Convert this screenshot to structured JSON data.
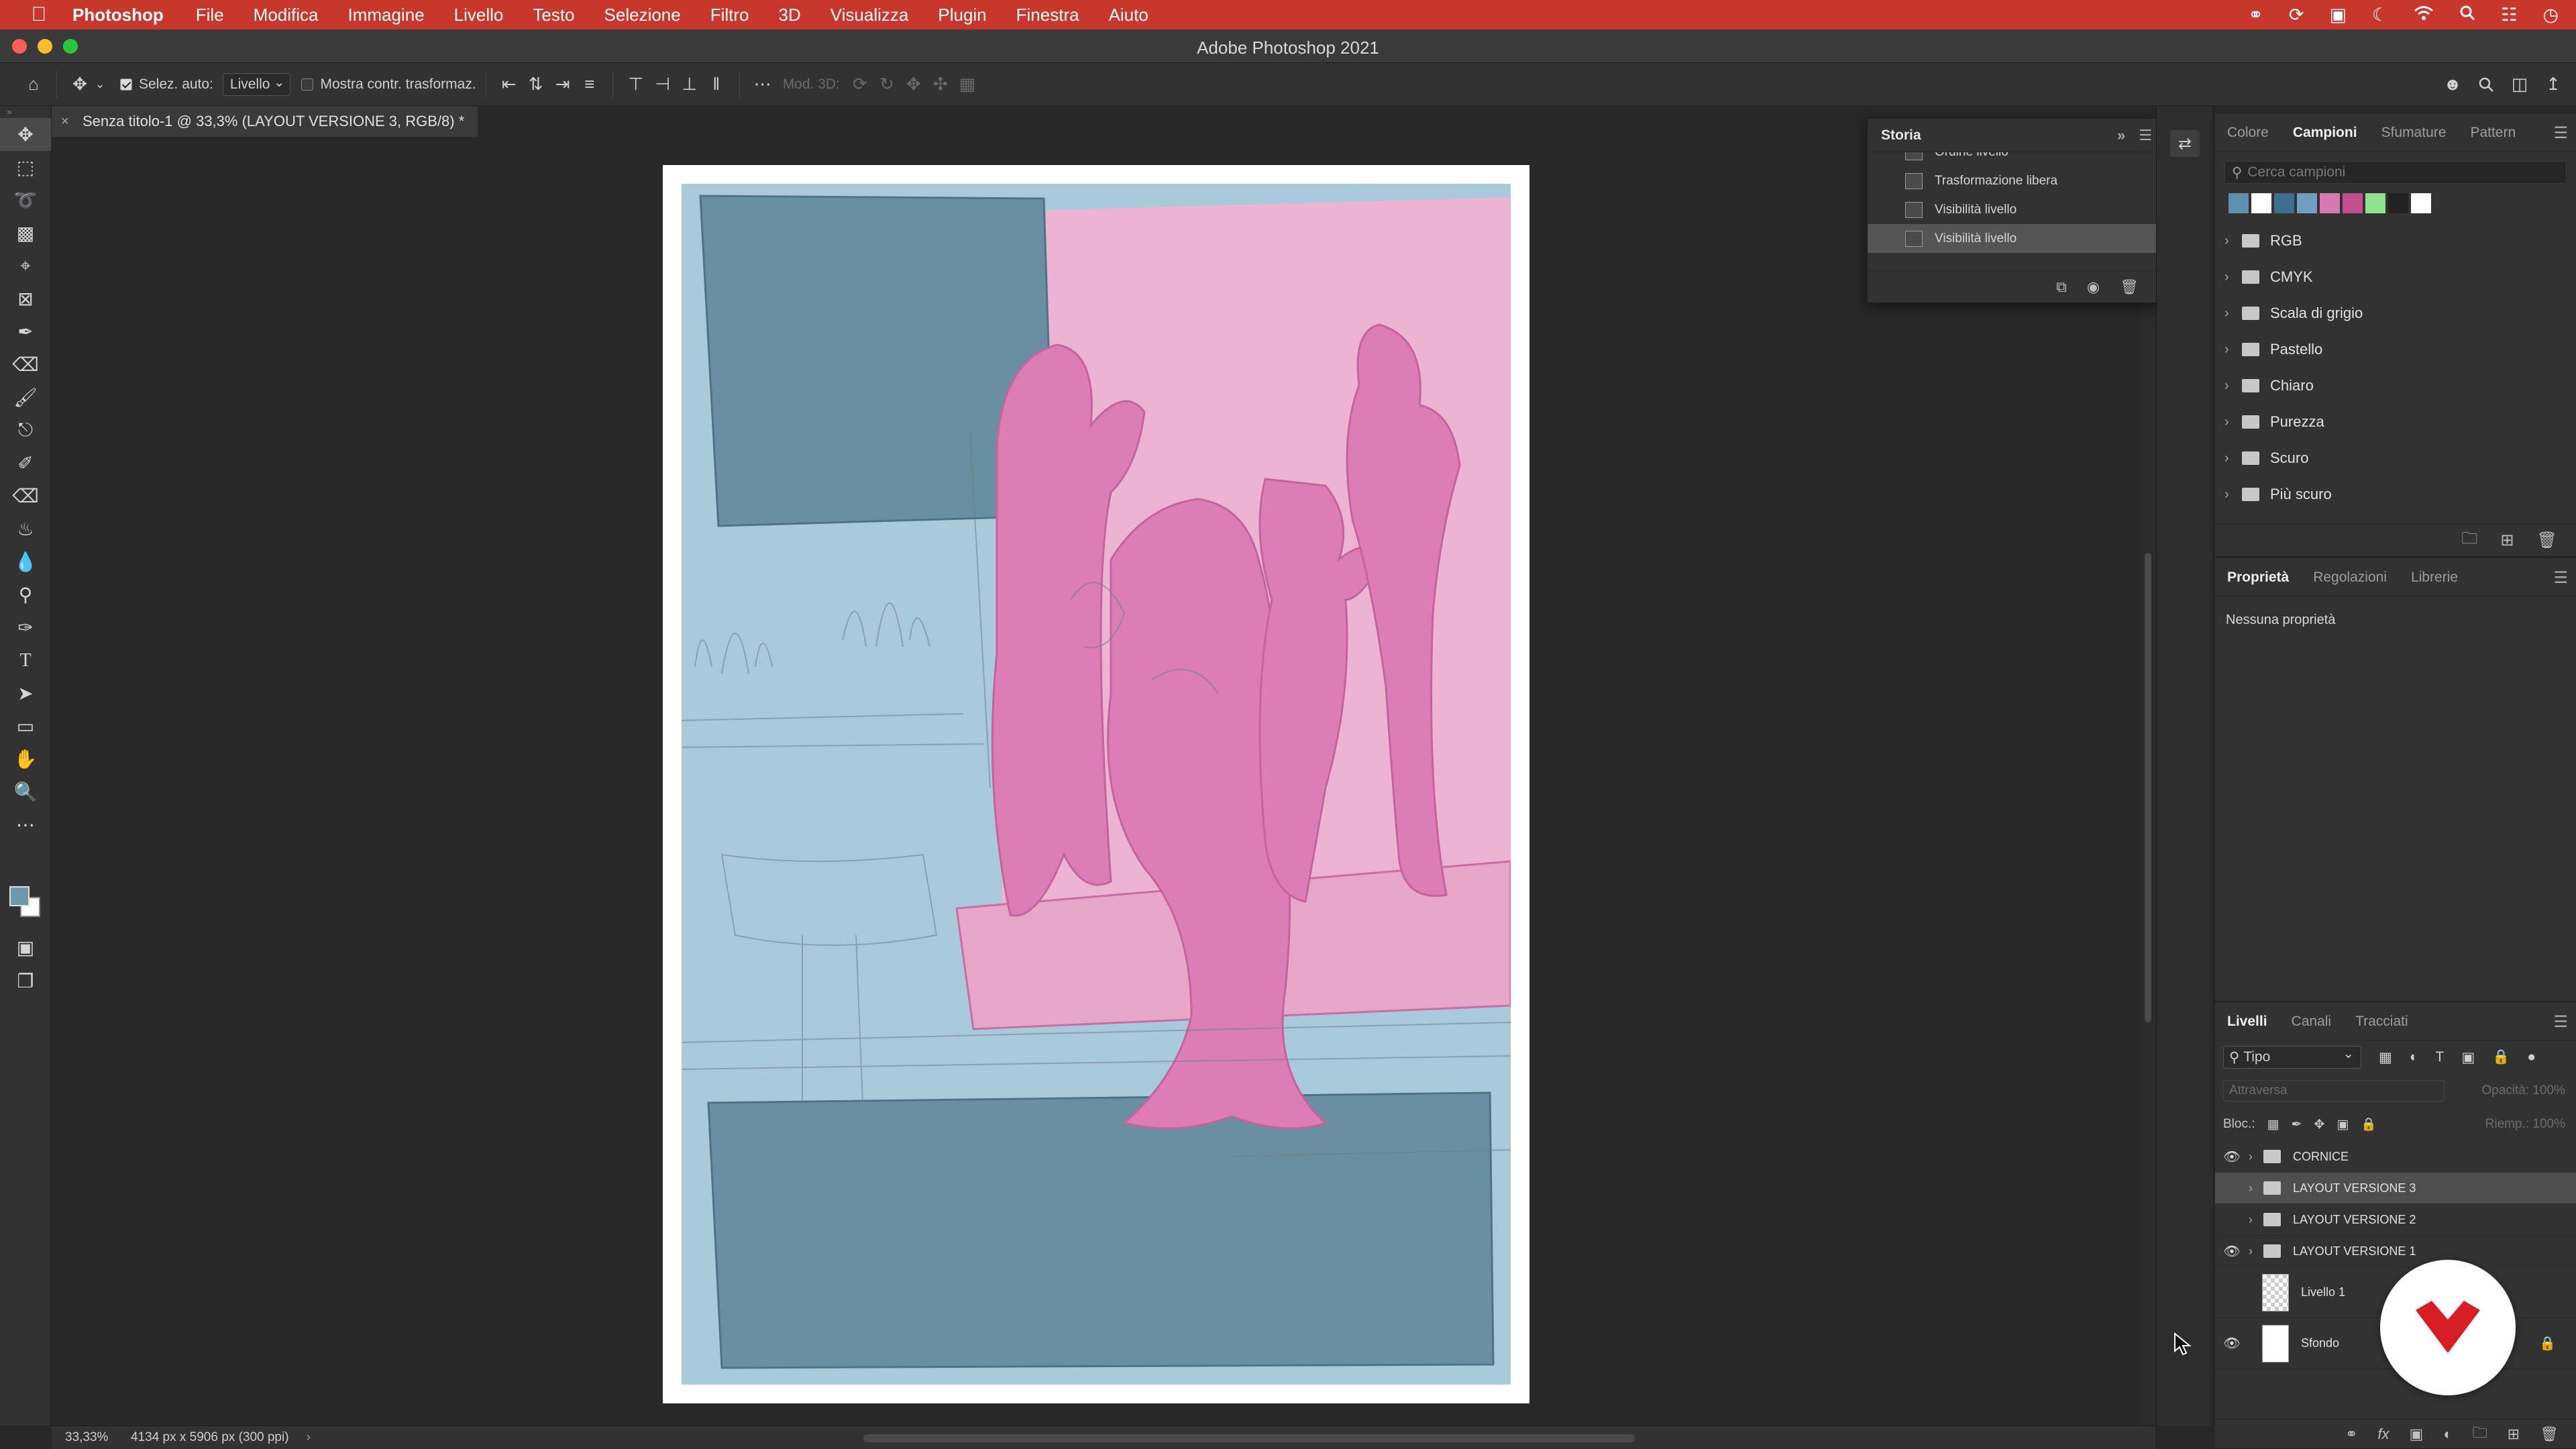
{
  "menubar": {
    "apple_icon": "apple-logo-icon",
    "app_name": "Photoshop",
    "items": [
      "File",
      "Modifica",
      "Immagine",
      "Livello",
      "Testo",
      "Selezione",
      "Filtro",
      "3D",
      "Visualizza",
      "Plugin",
      "Finestra",
      "Aiuto"
    ],
    "status_icons": [
      "creative-cloud-icon",
      "sync-icon",
      "screen-mirroring-icon",
      "moon-icon",
      "wifi-icon",
      "spotlight-search-icon",
      "control-center-icon",
      "clock-icon"
    ]
  },
  "window": {
    "title": "Adobe Photoshop 2021"
  },
  "options_bar": {
    "auto_select_label": "Selez. auto:",
    "auto_select_checked": true,
    "auto_select_target": "Livello",
    "transform_controls_label": "Mostra contr. trasformaz.",
    "transform_controls_checked": false,
    "mode_3d_label": "Mod. 3D:"
  },
  "document_tab": {
    "close_glyph": "×",
    "title": "Senza titolo-1 @ 33,3% (LAYOUT VERSIONE 3, RGB/8) *"
  },
  "toolbar": {
    "tools": [
      "move-tool",
      "rectangular-marquee-tool",
      "lasso-tool",
      "object-selection-tool",
      "crop-tool",
      "frame-tool",
      "eyedropper-tool",
      "spot-healing-tool",
      "brush-tool",
      "clone-stamp-tool",
      "history-brush-tool",
      "eraser-tool",
      "paint-bucket-tool",
      "blur-tool",
      "dodge-tool",
      "pen-tool",
      "type-tool",
      "path-selection-tool",
      "rectangle-tool",
      "hand-tool",
      "zoom-tool",
      "edit-toolbar"
    ],
    "foreground_color": "#6f98ad",
    "background_color": "#ffffff"
  },
  "history_panel": {
    "title": "Storia",
    "items": [
      {
        "label": "Ordine livello",
        "selected": false
      },
      {
        "label": "Trasformazione libera",
        "selected": false
      },
      {
        "label": "Visibilità livello",
        "selected": false
      },
      {
        "label": "Visibilità livello",
        "selected": true
      }
    ]
  },
  "swatches_panel": {
    "tabs": [
      "Colore",
      "Campioni",
      "Sfumature",
      "Pattern"
    ],
    "active_tab": "Campioni",
    "search_placeholder": "Cerca campioni",
    "recent_swatches": [
      "#5f8fae",
      "#ffffff",
      "#3f6f8f",
      "#6f9ec0",
      "#d47ab0",
      "#c2508e",
      "#8fe08f",
      "#222222",
      "#ffffff"
    ],
    "groups": [
      "RGB",
      "CMYK",
      "Scala di grigio",
      "Pastello",
      "Chiaro",
      "Purezza",
      "Scuro",
      "Più scuro"
    ]
  },
  "properties_panel": {
    "tabs": [
      "Proprietà",
      "Regolazioni",
      "Librerie"
    ],
    "active_tab": "Proprietà",
    "empty_text": "Nessuna proprietà"
  },
  "layers_panel": {
    "tabs": [
      "Livelli",
      "Canali",
      "Tracciati"
    ],
    "active_tab": "Livelli",
    "filter_kind": "Tipo",
    "blend_mode": "Attraversa",
    "opacity_label": "Opacità:",
    "opacity_value": "100%",
    "lock_label": "Bloc.:",
    "fill_label": "Riemp.:",
    "fill_value": "100%",
    "layers": [
      {
        "name": "CORNICE",
        "type": "group",
        "visible": true,
        "selected": false
      },
      {
        "name": "LAYOUT VERSIONE 3",
        "type": "group",
        "visible": false,
        "selected": true
      },
      {
        "name": "LAYOUT VERSIONE 2",
        "type": "group",
        "visible": false,
        "selected": false
      },
      {
        "name": "LAYOUT VERSIONE 1",
        "type": "group",
        "visible": true,
        "selected": false
      },
      {
        "name": "Livello 1",
        "type": "pixel",
        "visible": false,
        "selected": false
      },
      {
        "name": "Sfondo",
        "type": "background",
        "visible": true,
        "selected": false,
        "locked": true
      }
    ]
  },
  "statusbar": {
    "zoom": "33,33%",
    "doc_info": "4134 px x 5906 px (300 ppi)"
  },
  "artwork_colors": {
    "sky": "#a9cadb",
    "panel": "#6a8fa2",
    "pink_bg": "#ecb3d2",
    "figure": "#dd7db5",
    "sketch": "#6e7f8c"
  }
}
